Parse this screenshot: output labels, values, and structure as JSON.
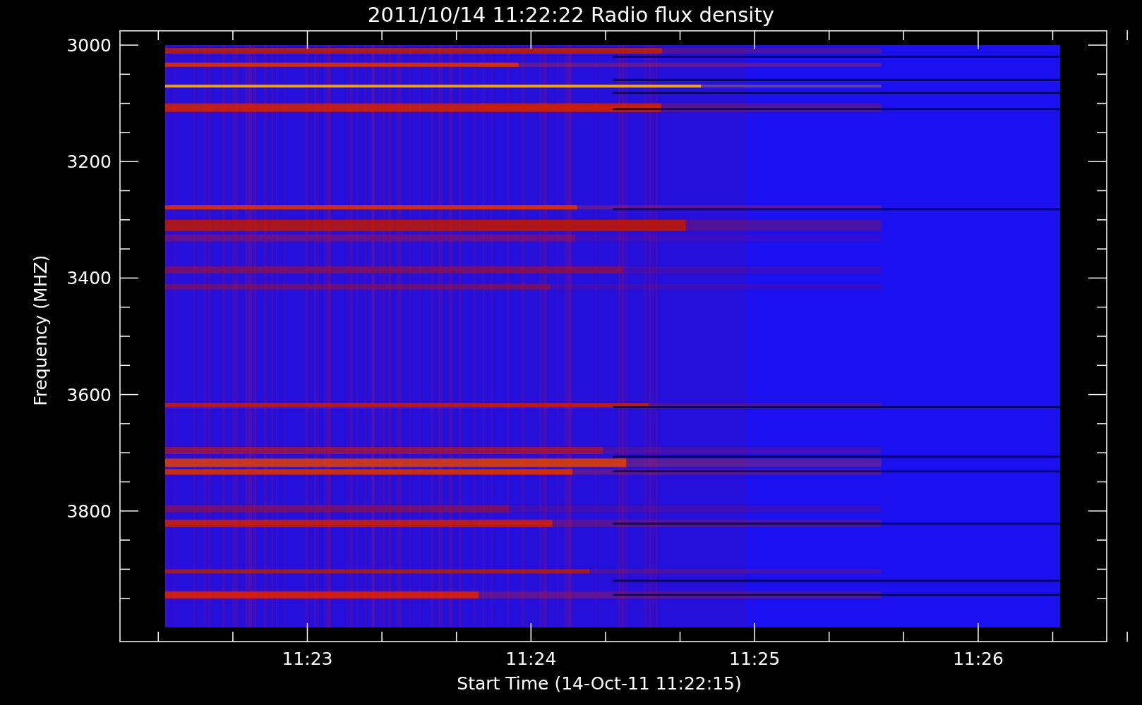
{
  "title": "2011/10/14 11:22:22 Radio flux density",
  "y_axis": {
    "label": "Frequency (MHZ)",
    "ticks": [
      "3000",
      "3200",
      "3400",
      "3600",
      "3800"
    ]
  },
  "x_axis": {
    "label": "Start Time (14-Oct-11 11:22:15)",
    "ticks": [
      "11:23",
      "11:24",
      "11:25",
      "11:26"
    ]
  }
}
